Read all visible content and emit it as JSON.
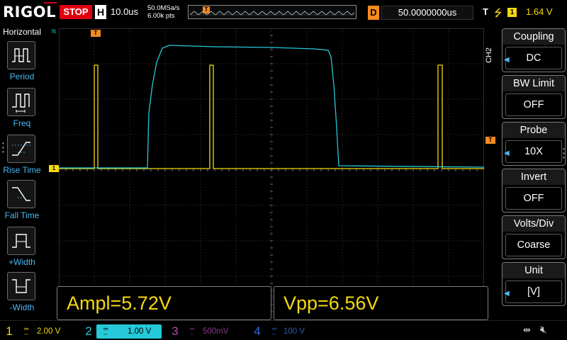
{
  "topbar": {
    "brand": "RIGOL",
    "run_state": "STOP",
    "h_badge": "H",
    "timebase": "10.0us",
    "sample_rate": "50.0MSa/s",
    "mem_depth": "6.00k pts",
    "mem_marker": "T",
    "delay_badge": "D",
    "delay_value": "50.0000000us",
    "trigger_badge": "T",
    "trigger_source": "1",
    "trigger_level": "1.64 V",
    "colors": {
      "run_state": "#e0000f",
      "trigger": "#f5d90f",
      "delay": "#f58a1f"
    }
  },
  "left_menu": {
    "title": "Horizontal",
    "items": [
      {
        "label": "Period",
        "icon": "period-icon"
      },
      {
        "label": "Freq",
        "icon": "freq-icon"
      },
      {
        "label": "Rise Time",
        "icon": "rise-time-icon"
      },
      {
        "label": "Fall Time",
        "icon": "fall-time-icon"
      },
      {
        "label": "+Width",
        "icon": "pos-width-icon"
      },
      {
        "label": "-Width",
        "icon": "neg-width-icon"
      }
    ]
  },
  "grid": {
    "ch1_marker": "1",
    "trigger_pos_marker": "T",
    "trigger_level_marker": "T",
    "colors": {
      "ch1": "#f5d90f",
      "ch2": "#25c9d8",
      "grid": "#3c3c3c"
    }
  },
  "measurements": [
    {
      "text": "Ampl=5.72V"
    },
    {
      "text": "Vpp=6.56V"
    }
  ],
  "right_menu": {
    "channel_tag": "CH2",
    "items": [
      {
        "title": "Coupling",
        "value": "DC"
      },
      {
        "title": "BW Limit",
        "value": "OFF"
      },
      {
        "title": "Probe",
        "value": "10X"
      },
      {
        "title": "Invert",
        "value": "OFF"
      },
      {
        "title": "Volts/Div",
        "value": "Coarse"
      },
      {
        "title": "Unit",
        "value": "[V]"
      }
    ]
  },
  "channels": [
    {
      "num": "1",
      "scale": "2.00 V",
      "color": "#f5d90f",
      "active": false
    },
    {
      "num": "2",
      "scale": "1.00 V",
      "color": "#25c9d8",
      "active": true
    },
    {
      "num": "3",
      "scale": "500mV",
      "color": "#c030c0",
      "active": false
    },
    {
      "num": "4",
      "scale": "100 V",
      "color": "#2f6fd6",
      "active": false
    }
  ],
  "status": {
    "usb_icon": "usb-icon",
    "sound_icon": "speaker-muted-icon"
  }
}
